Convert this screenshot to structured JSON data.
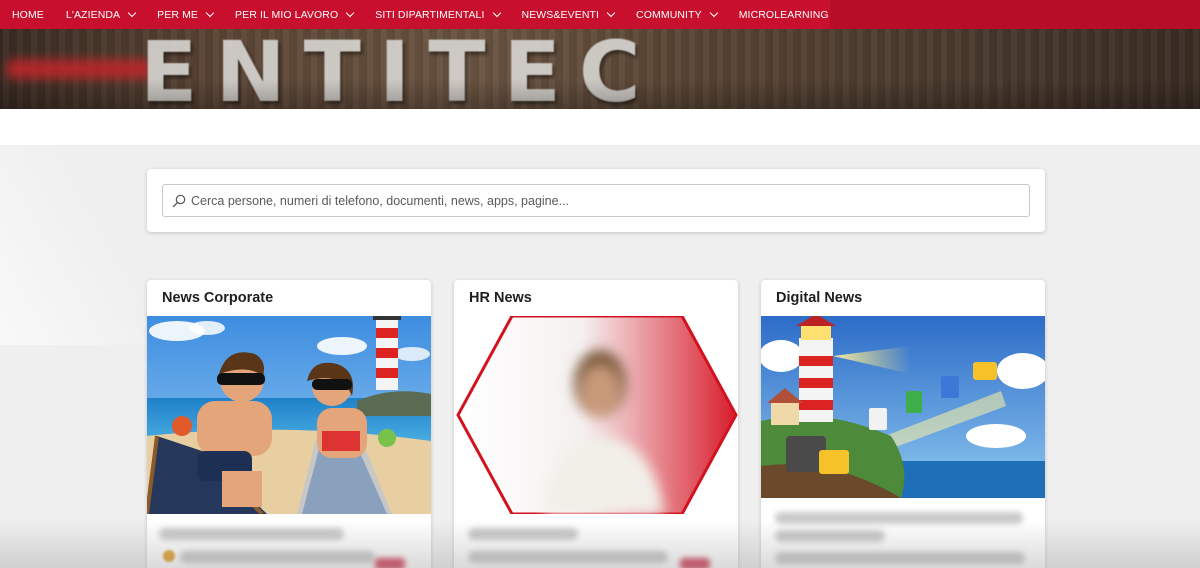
{
  "nav": {
    "items": [
      {
        "label": "HOME",
        "dropdown": false
      },
      {
        "label": "L'AZIENDA",
        "dropdown": true
      },
      {
        "label": "PER ME",
        "dropdown": true
      },
      {
        "label": "PER IL MIO LAVORO",
        "dropdown": true
      },
      {
        "label": "SITI DIPARTIMENTALI",
        "dropdown": true
      },
      {
        "label": "NEWS&EVENTI",
        "dropdown": true
      },
      {
        "label": "COMMUNITY",
        "dropdown": true
      },
      {
        "label": "MICROLEARNING",
        "dropdown": true
      }
    ]
  },
  "search": {
    "placeholder": "Cerca persone, numeri di telefono, documenti, news, apps, pagine...",
    "icon": "search-icon"
  },
  "cards": [
    {
      "title": "News Corporate",
      "image": "beach-couple-lighthouse-illustration"
    },
    {
      "title": "HR News",
      "image": "person-portrait-red-hexagon"
    },
    {
      "title": "Digital News",
      "image": "lighthouse-flying-documents-illustration"
    }
  ],
  "colors": {
    "brand": "#c8102e",
    "background": "#efefef",
    "card": "#ffffff"
  }
}
